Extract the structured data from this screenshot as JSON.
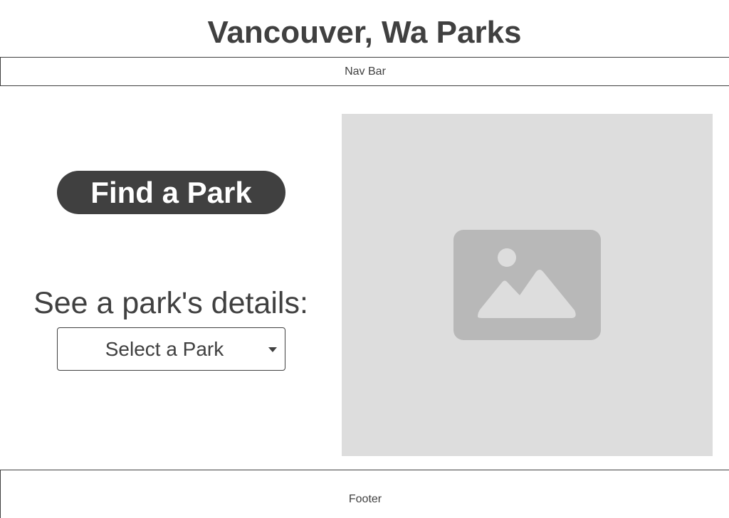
{
  "header": {
    "title": "Vancouver, Wa Parks"
  },
  "navbar": {
    "label": "Nav Bar"
  },
  "main": {
    "find_button_label": "Find a Park",
    "details_label": "See a park's details:",
    "park_select": {
      "selected": "Select a Park"
    },
    "image_placeholder": {
      "icon": "image-icon"
    }
  },
  "footer": {
    "label": "Footer"
  },
  "colors": {
    "text": "#404040",
    "button_bg": "#404040",
    "button_text": "#ffffff",
    "placeholder_bg": "#dddddd",
    "placeholder_icon": "#b8b8b8"
  }
}
